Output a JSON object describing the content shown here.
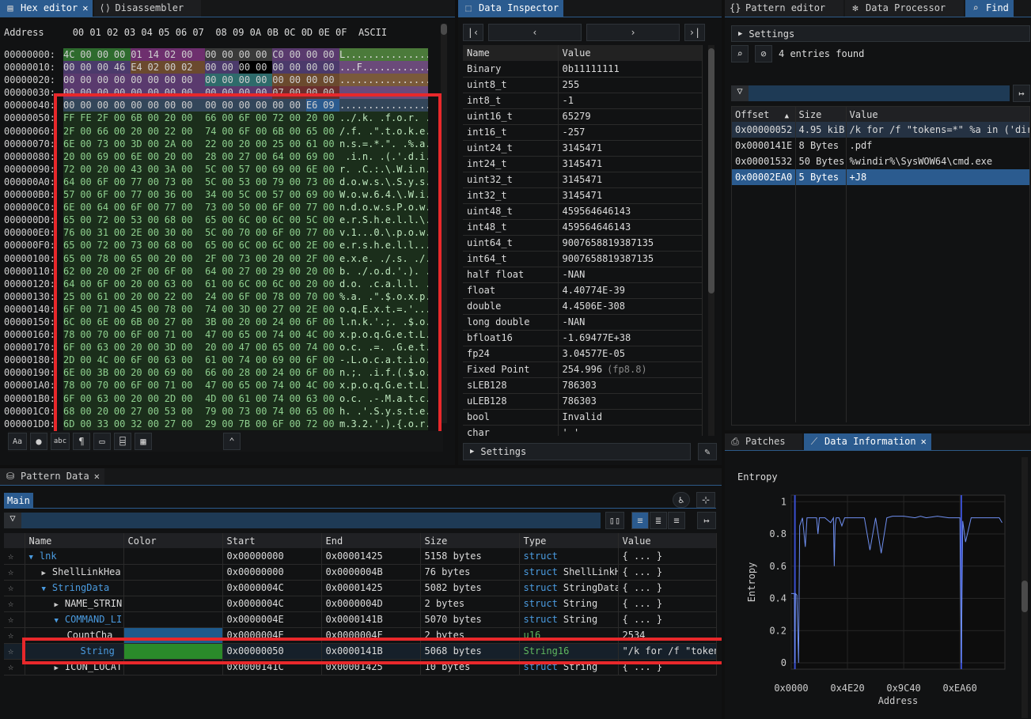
{
  "tabs": {
    "hex_editor": "Hex editor",
    "disassembler": "Disassembler",
    "data_inspector": "Data Inspector",
    "pattern_editor": "Pattern editor",
    "data_processor": "Data Processor",
    "find": "Find",
    "pattern_data": "Pattern Data",
    "patches": "Patches",
    "data_information": "Data Information"
  },
  "hex": {
    "address_label": "Address",
    "columns": "00 01 02 03 04 05 06 07  08 09 0A 0B 0C 0D 0E 0F",
    "ascii_label": "ASCII",
    "addresses": [
      "00000000:",
      "00000010:",
      "00000020:",
      "00000030:",
      "00000040:",
      "00000050:",
      "00000060:",
      "00000070:",
      "00000080:",
      "00000090:",
      "000000A0:",
      "000000B0:",
      "000000C0:",
      "000000D0:",
      "000000E0:",
      "000000F0:",
      "00000100:",
      "00000110:",
      "00000120:",
      "00000130:",
      "00000140:",
      "00000150:",
      "00000160:",
      "00000170:",
      "00000180:",
      "00000190:",
      "000001A0:",
      "000001B0:",
      "000001C0:",
      "000001D0:"
    ],
    "rows": [
      "4C 00 00 00 01 14 02 00  00 00 00 00 C0 00 00 00",
      "00 00 00 46 E4 02 00 02  00 00 00 00 00 00 00 00",
      "00 00 00 00 00 00 00 00  00 00 00 00 00 00 00 00",
      "00 00 00 00 00 00 00 00  00 00 00 00 07 00 00 00",
      "00 00 00 00 00 00 00 00  00 00 00 00 00 00 E6 09",
      "FF FE 2F 00 6B 00 20 00  66 00 6F 00 72 00 20 00",
      "2F 00 66 00 20 00 22 00  74 00 6F 00 6B 00 65 00",
      "6E 00 73 00 3D 00 2A 00  22 00 20 00 25 00 61 00",
      "20 00 69 00 6E 00 20 00  28 00 27 00 64 00 69 00",
      "72 00 20 00 43 00 3A 00  5C 00 57 00 69 00 6E 00",
      "64 00 6F 00 77 00 73 00  5C 00 53 00 79 00 73 00",
      "57 00 6F 00 77 00 36 00  34 00 5C 00 57 00 69 00",
      "6E 00 64 00 6F 00 77 00  73 00 50 00 6F 00 77 00",
      "65 00 72 00 53 00 68 00  65 00 6C 00 6C 00 5C 00",
      "76 00 31 00 2E 00 30 00  5C 00 70 00 6F 00 77 00",
      "65 00 72 00 73 00 68 00  65 00 6C 00 6C 00 2E 00",
      "65 00 78 00 65 00 20 00  2F 00 73 00 20 00 2F 00",
      "62 00 20 00 2F 00 6F 00  64 00 27 00 29 00 20 00",
      "64 00 6F 00 20 00 63 00  61 00 6C 00 6C 00 20 00",
      "25 00 61 00 20 00 22 00  24 00 6F 00 78 00 70 00",
      "6F 00 71 00 45 00 78 00  74 00 3D 00 27 00 2E 00",
      "6C 00 6E 00 6B 00 27 00  3B 00 20 00 24 00 6F 00",
      "78 00 70 00 6F 00 71 00  47 00 65 00 74 00 4C 00",
      "6F 00 63 00 20 00 3D 00  20 00 47 00 65 00 74 00",
      "2D 00 4C 00 6F 00 63 00  61 00 74 00 69 00 6F 00",
      "6E 00 3B 00 20 00 69 00  66 00 28 00 24 00 6F 00",
      "78 00 70 00 6F 00 71 00  47 00 65 00 74 00 4C 00",
      "6F 00 63 00 20 00 2D 00  4D 00 61 00 74 00 63 00",
      "68 00 20 00 27 00 53 00  79 00 73 00 74 00 65 00",
      "6D 00 33 00 32 00 27 00  29 00 7B 00 6F 00 72 00"
    ],
    "ascii_rows": [
      "L...............",
      "...F............",
      "................",
      "................",
      "................",
      "../.k. .f.o.r. .",
      "/.f. .\".t.o.k.e.",
      "n.s.=.*.\". .%.a.",
      " .i.n. .(.'.d.i.",
      "r. .C.:.\\.W.i.n.",
      "d.o.w.s.\\.S.y.s.",
      "W.o.w.6.4.\\.W.i.",
      "n.d.o.w.s.P.o.w.",
      "e.r.S.h.e.l.l.\\.",
      "v.1...0.\\.p.o.w.",
      "e.r.s.h.e.l.l...",
      "e.x.e. ./.s. ./.",
      "b. ./.o.d.'.). .",
      "d.o. .c.a.l.l. .",
      "%.a. .\".$.o.x.p.",
      "o.q.E.x.t.=.'...",
      "l.n.k.'.;. .$.o.",
      "x.p.o.q.G.e.t.L.",
      "o.c. .=. .G.e.t.",
      "-.L.o.c.a.t.i.o.",
      "n.;. .i.f.(.$.o.",
      "x.p.o.q.G.e.t.L.",
      "o.c. .-.M.a.t.c.",
      "h. .'.S.y.s.t.e.",
      "m.3.2.'.).{.o.r."
    ]
  },
  "inspector": {
    "col_name": "Name",
    "col_value": "Value",
    "rows": [
      {
        "name": "Binary",
        "value": "0b11111111"
      },
      {
        "name": "uint8_t",
        "value": "255"
      },
      {
        "name": "int8_t",
        "value": "-1"
      },
      {
        "name": "uint16_t",
        "value": "65279"
      },
      {
        "name": "int16_t",
        "value": "-257"
      },
      {
        "name": "uint24_t",
        "value": "3145471"
      },
      {
        "name": "int24_t",
        "value": "3145471"
      },
      {
        "name": "uint32_t",
        "value": "3145471"
      },
      {
        "name": "int32_t",
        "value": "3145471"
      },
      {
        "name": "uint48_t",
        "value": "459564646143"
      },
      {
        "name": "int48_t",
        "value": "459564646143"
      },
      {
        "name": "uint64_t",
        "value": "9007658819387135"
      },
      {
        "name": "int64_t",
        "value": "9007658819387135"
      },
      {
        "name": "half float",
        "value": "-NAN"
      },
      {
        "name": "float",
        "value": "4.40774E-39"
      },
      {
        "name": "double",
        "value": "4.4506E-308"
      },
      {
        "name": "long double",
        "value": "-NAN"
      },
      {
        "name": "bfloat16",
        "value": "-1.69477E+38"
      },
      {
        "name": "fp24",
        "value": "3.04577E-05"
      },
      {
        "name": "Fixed Point",
        "value": "254.996",
        "extra": "(fp8.8)"
      },
      {
        "name": "sLEB128",
        "value": "786303"
      },
      {
        "name": "uLEB128",
        "value": "786303"
      },
      {
        "name": "bool",
        "value": "Invalid"
      },
      {
        "name": "char",
        "value": "' '"
      }
    ],
    "settings": "Settings"
  },
  "find": {
    "settings": "Settings",
    "entries_found": "4 entries found",
    "col_offset": "Offset",
    "col_size": "Size",
    "col_value": "Value",
    "rows": [
      {
        "offset": "0x00000052",
        "size": "4.95 kiB",
        "value": "/k for /f \"tokens=*\" %a in ('dir"
      },
      {
        "offset": "0x0000141E",
        "size": "8 Bytes",
        "value": ".pdf"
      },
      {
        "offset": "0x00001532",
        "size": "50 Bytes",
        "value": "%windir%\\SysWOW64\\cmd.exe"
      },
      {
        "offset": "0x00002EA0",
        "size": "5 Bytes",
        "value": "+J8"
      }
    ]
  },
  "pattern": {
    "main_tab": "Main",
    "columns": [
      "Name",
      "Color",
      "Start",
      "End",
      "Size",
      "Type",
      "Value"
    ],
    "rows": [
      {
        "name": "lnk",
        "start": "0x00000000",
        "end": "0x00001425",
        "size": "5158 bytes",
        "kw": "struct",
        "type": "",
        "value": "{ ... }",
        "arrow": "▼",
        "indent": 0
      },
      {
        "name": "ShellLinkHea",
        "start": "0x00000000",
        "end": "0x0000004B",
        "size": "76 bytes",
        "kw": "struct",
        "type": "ShellLinkH",
        "value": "{ ... }",
        "arrow": "▶",
        "indent": 1
      },
      {
        "name": "StringData",
        "start": "0x0000004C",
        "end": "0x00001425",
        "size": "5082 bytes",
        "kw": "struct",
        "type": "StringData",
        "value": "{ ... }",
        "arrow": "▼",
        "indent": 1
      },
      {
        "name": "NAME_STRIN",
        "start": "0x0000004C",
        "end": "0x0000004D",
        "size": "2 bytes",
        "kw": "struct",
        "type": "String",
        "value": "{ ... }",
        "arrow": "▶",
        "indent": 2
      },
      {
        "name": "COMMAND_LI",
        "start": "0x0000004E",
        "end": "0x0000141B",
        "size": "5070 bytes",
        "kw": "struct",
        "type": "String",
        "value": "{ ... }",
        "arrow": "▼",
        "indent": 2
      },
      {
        "name": "CountCha",
        "start": "0x0000004E",
        "end": "0x0000004F",
        "size": "2 bytes",
        "kw": "u16",
        "type": "",
        "value": "2534",
        "arrow": "",
        "indent": 3
      },
      {
        "name": "String",
        "start": "0x00000050",
        "end": "0x0000141B",
        "size": "5068 bytes",
        "kw": "String16",
        "type": "",
        "value": "\"/k for /f \"token",
        "arrow": "",
        "indent": 3
      },
      {
        "name": "ICON_LOCAT",
        "start": "0x0000141C",
        "end": "0x00001425",
        "size": "10 bytes",
        "kw": "struct",
        "type": "String",
        "value": "{ ... }",
        "arrow": "▶",
        "indent": 2
      }
    ]
  },
  "entropy": {
    "title": "Entropy",
    "ylabel": "Entropy",
    "xlabel": "Address",
    "chart_data": {
      "type": "line",
      "title": "Entropy",
      "xlabel": "Address",
      "ylabel": "Entropy",
      "ylim": [
        0,
        1
      ],
      "yticks": [
        "0",
        "0.2",
        "0.4",
        "0.6",
        "0.8",
        "1"
      ],
      "xticks": [
        "0x0000",
        "0x4E20",
        "0x9C40",
        "0xEA60"
      ],
      "x": [
        0,
        500,
        1100,
        1300,
        1500,
        2000,
        2600,
        3000,
        4000,
        5000,
        5600,
        6000,
        7000,
        8000,
        9000,
        9500,
        10000,
        12000,
        14000,
        15000,
        15300,
        15600,
        16000,
        17000,
        18000,
        19000,
        20000,
        22000,
        24000,
        26000,
        28000,
        30000,
        32000,
        34000,
        36000,
        40000,
        44000,
        46000,
        48000,
        52000,
        56000,
        58000,
        60000,
        60500,
        61000,
        62000,
        64000,
        66000,
        68000,
        70000,
        72000,
        74000,
        75000
      ],
      "y": [
        0.43,
        0.43,
        0.43,
        0.0,
        0.43,
        0.42,
        0.0,
        0.85,
        0.9,
        0.72,
        0.9,
        0.9,
        0.9,
        0.9,
        0.9,
        0.8,
        0.9,
        0.9,
        0.87,
        0.9,
        0.6,
        0.85,
        0.9,
        0.9,
        0.85,
        0.9,
        0.9,
        0.9,
        0.9,
        0.9,
        0.7,
        0.9,
        0.68,
        0.9,
        0.91,
        0.91,
        0.9,
        0.91,
        0.9,
        0.91,
        0.9,
        0.9,
        0.9,
        0.0,
        0.88,
        0.75,
        0.9,
        0.9,
        0.9,
        0.9,
        0.9,
        0.9,
        0.87
      ]
    }
  }
}
